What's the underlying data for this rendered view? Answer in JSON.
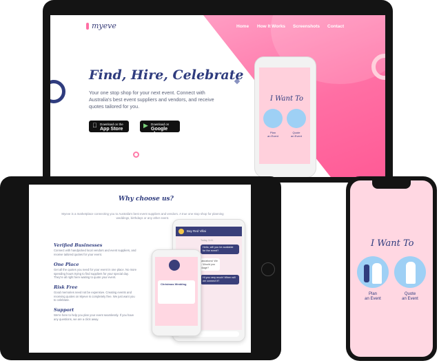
{
  "brand": {
    "logo": "myeve",
    "accent": "#ff6fa4",
    "navy": "#2f3c7e"
  },
  "nav": [
    "Home",
    "How It Works",
    "Screenshots",
    "Contact"
  ],
  "hero": {
    "title": "Find, Hire, Celebrate",
    "subtitle": "Your one stop shop for your next event. Connect with Australia's best event suppliers and vendors, and receive quotes tailored for you.",
    "appstore": {
      "small": "Download on the",
      "big": "App Store",
      "icon": "apple-icon"
    },
    "googleplay": {
      "small": "Download on",
      "big": "Google play",
      "icon": "play-icon"
    }
  },
  "phone_app": {
    "heading": "I Want To",
    "option_plan": "Plan\nan Event",
    "option_quote": "Quote\nan Event"
  },
  "why": {
    "title": "Why choose us?",
    "intro": "Myeve is a marketplace connecting you to Australia's best event suppliers and vendors. A true one stop shop for planning weddings, birthdays or any other event.",
    "features": [
      {
        "title": "Verified Businesses",
        "text": "Connect with handpicked local vendors and event suppliers, and receive tailored quotes for your event."
      },
      {
        "title": "One Place",
        "text": "Get all the quotes you need for your event in one place. No more spending hours trying to find suppliers for your special day. They're all right here waiting to quote your event."
      },
      {
        "title": "Risk Free",
        "text": "Good memories need not be expensive. Creating events and receiving quotes on Myeve is completely free. We just want you to celebrate."
      },
      {
        "title": "Support",
        "text": "We're here to help you plan your event seamlessly. If you have any questions, we are a click away."
      }
    ]
  },
  "chat": {
    "header": "Bay Red Villai",
    "date": "Today, 5:41",
    "messages": [
      "Hello, will you be available for the event?",
      "Absolutely! Congratulations! We can do your event. Would you like to see our package?",
      "Hi you very much! When will we connect it?"
    ],
    "input_placeholder": "Type a message",
    "card_title": "Christmas Wedding"
  }
}
